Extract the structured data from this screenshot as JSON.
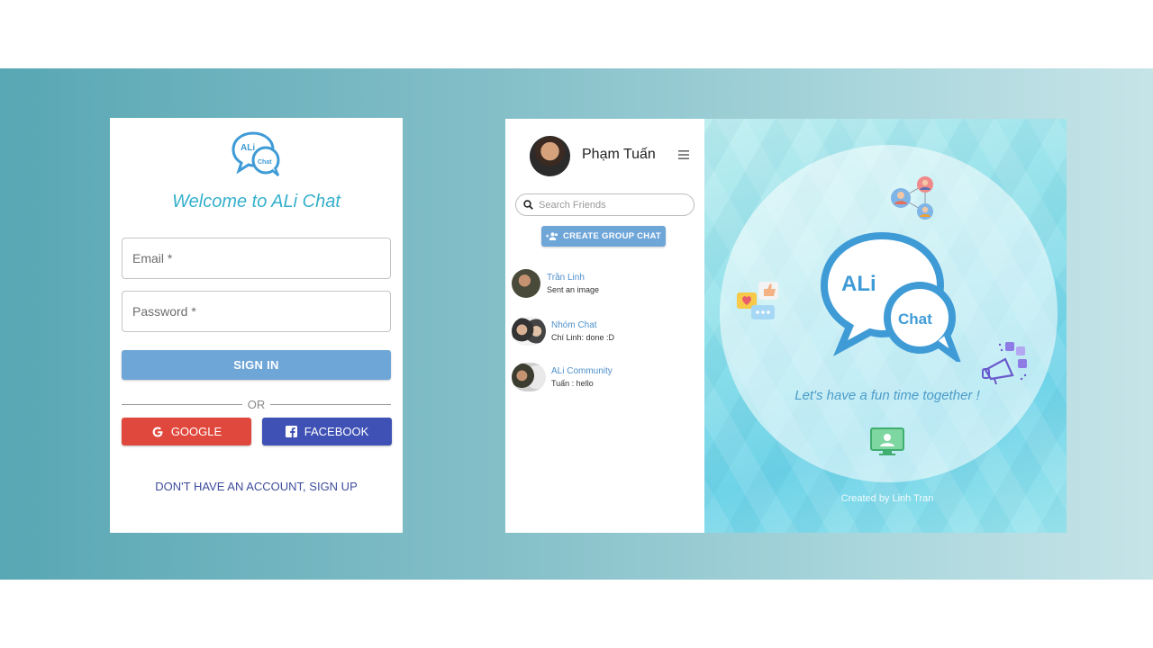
{
  "login": {
    "logo_top": "ALi",
    "logo_bottom": "Chat",
    "welcome": "Welcome to ALi Chat",
    "email_label": "Email *",
    "password_label": "Password *",
    "signin_label": "SIGN IN",
    "or_label": "OR",
    "google_label": "GOOGLE",
    "facebook_label": "FACEBOOK",
    "signup_label": "DON'T HAVE AN ACCOUNT, SIGN UP"
  },
  "chat": {
    "user_name": "Phạm Tuấn",
    "search_placeholder": "Search Friends",
    "create_group_label": "CREATE GROUP CHAT",
    "conversations": [
      {
        "name": "Trần Linh",
        "last_message": "Sent an image"
      },
      {
        "name": "Nhóm Chat",
        "last_message": "Chí Linh: done :D"
      },
      {
        "name": "ALi Community",
        "last_message": "Tuấn : hello"
      }
    ],
    "hero": {
      "logo_top": "ALi",
      "logo_bottom": "Chat",
      "tagline": "Let's have a fun time together !",
      "credit": "Created by Linh Tran"
    }
  },
  "colors": {
    "accent": "#35b0cc",
    "button_blue": "#6fa6d8",
    "google_red": "#e0483d",
    "facebook_blue": "#3f51b5",
    "link_indigo": "#3e4c9c"
  }
}
